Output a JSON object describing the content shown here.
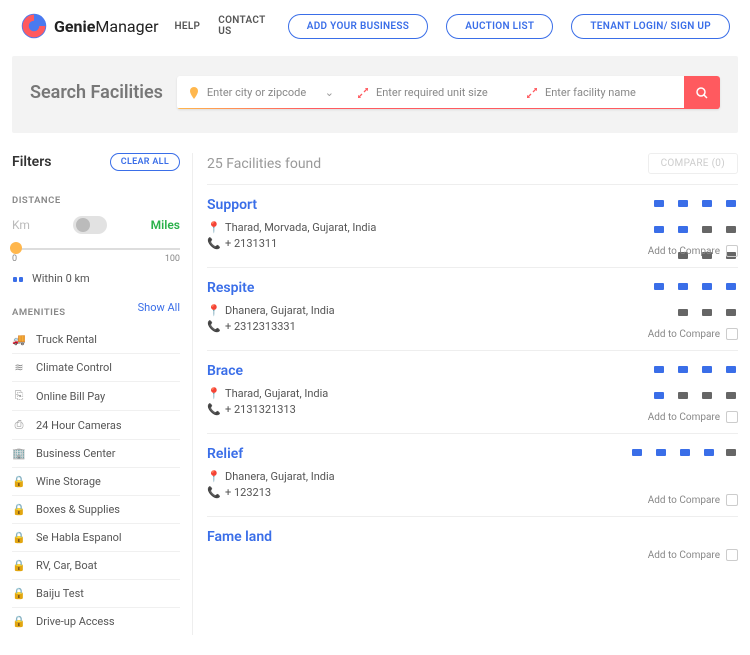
{
  "brand": {
    "name_bold": "Genie",
    "name_rest": "Manager"
  },
  "nav": {
    "help": "HELP",
    "contact": "CONTACT US",
    "add": "ADD YOUR BUSINESS",
    "auction": "AUCTION LIST",
    "tenant": "TENANT LOGIN/ SIGN UP"
  },
  "search": {
    "title": "Search Facilities",
    "city": "Enter city or zipcode",
    "size": "Enter required unit size",
    "name": "Enter facility name"
  },
  "filters": {
    "title": "Filters",
    "clear": "CLEAR ALL",
    "distance_label": "DISTANCE",
    "km": "Km",
    "miles": "Miles",
    "range_min": "0",
    "range_max": "100",
    "within": "Within 0 km",
    "amen_label": "AMENITIES",
    "showall": "Show All",
    "amenities": [
      "Truck Rental",
      "Climate Control",
      "Online Bill Pay",
      "24 Hour Cameras",
      "Business Center",
      "Wine Storage",
      "Boxes & Supplies",
      "Se Habla Espanol",
      "RV, Car, Boat",
      "Baiju Test",
      "Drive-up Access"
    ]
  },
  "results": {
    "count": "25 Facilities found",
    "compare": "COMPARE (0)",
    "add_compare": "Add to Compare",
    "items": [
      {
        "name": "Support",
        "addr": "Tharad, Morvada, Gujarat, India",
        "phone": "+ 2131311",
        "icon_rows": [
          [
            "ib",
            "ib",
            "ib",
            "ib"
          ],
          [
            "ib",
            "ib",
            "ig",
            "ig"
          ],
          [
            "ig",
            "ig",
            "ig"
          ]
        ]
      },
      {
        "name": "Respite",
        "addr": "Dhanera, Gujarat, India",
        "phone": "+ 2312313331",
        "icon_rows": [
          [
            "ib",
            "ib",
            "ib",
            "ib"
          ],
          [
            "ig",
            "ig",
            "ig"
          ]
        ]
      },
      {
        "name": "Brace",
        "addr": "Tharad, Gujarat, India",
        "phone": "+ 2131321313",
        "icon_rows": [
          [
            "ib",
            "ib",
            "ib",
            "ib"
          ],
          [
            "ib",
            "ig",
            "ig",
            "ig"
          ]
        ]
      },
      {
        "name": "Relief",
        "addr": "Dhanera, Gujarat, India",
        "phone": "+ 123213",
        "icon_rows": [
          [
            "ib",
            "ib",
            "ib",
            "ib"
          ],
          [
            "ig"
          ]
        ]
      }
    ],
    "last": {
      "name": "Fame land"
    }
  }
}
